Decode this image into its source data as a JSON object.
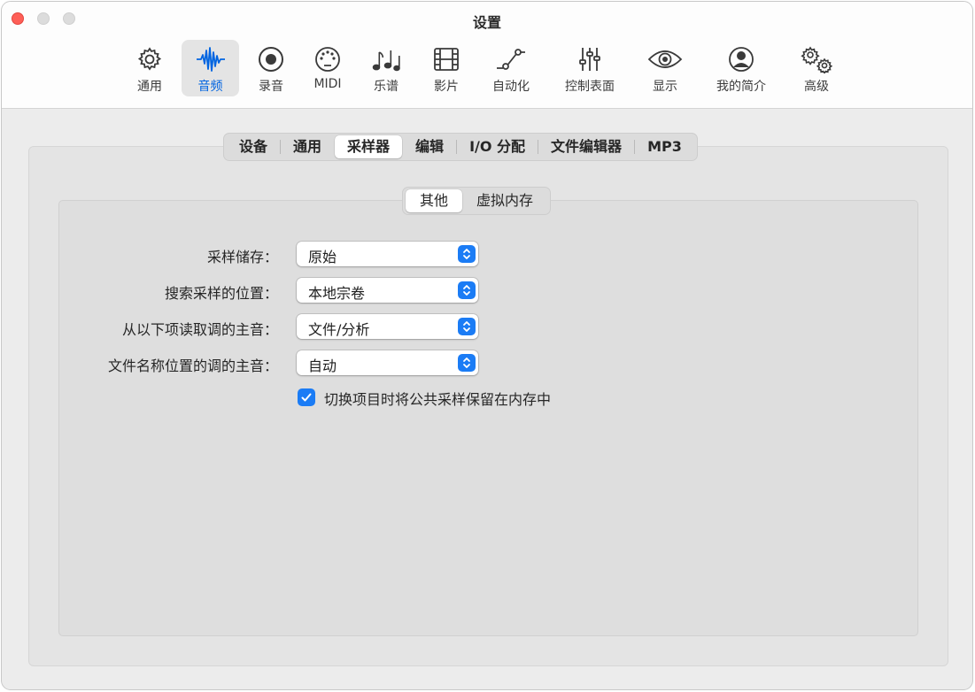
{
  "window": {
    "title": "设置"
  },
  "toolbar": {
    "items": [
      {
        "label": "通用",
        "icon": "gear-icon"
      },
      {
        "label": "音频",
        "icon": "waveform-icon",
        "active": true
      },
      {
        "label": "录音",
        "icon": "record-icon"
      },
      {
        "label": "MIDI",
        "icon": "midi-connector-icon"
      },
      {
        "label": "乐谱",
        "icon": "music-notes-icon"
      },
      {
        "label": "影片",
        "icon": "film-icon"
      },
      {
        "label": "自动化",
        "icon": "automation-curve-icon"
      },
      {
        "label": "控制表面",
        "icon": "sliders-icon"
      },
      {
        "label": "显示",
        "icon": "eye-icon"
      },
      {
        "label": "我的简介",
        "icon": "person-circle-icon"
      },
      {
        "label": "高级",
        "icon": "gears-icon"
      }
    ]
  },
  "tabs": {
    "items": [
      "设备",
      "通用",
      "采样器",
      "编辑",
      "I/O 分配",
      "文件编辑器",
      "MP3"
    ],
    "active": "采样器"
  },
  "subtabs": {
    "items": [
      "其他",
      "虚拟内存"
    ],
    "active": "其他"
  },
  "settings": {
    "rows": [
      {
        "label": "采样储存：",
        "value": "原始"
      },
      {
        "label": "搜索采样的位置：",
        "value": "本地宗卷"
      },
      {
        "label": "从以下项读取调的主音：",
        "value": "文件/分析"
      },
      {
        "label": "文件名称位置的调的主音：",
        "value": "自动"
      }
    ],
    "checkbox": {
      "label": "切换项目时将公共采样保留在内存中",
      "checked": true
    }
  },
  "colors": {
    "accent": "#1b7cf5",
    "active_label": "#0064e1",
    "close_button": "#fe5f57"
  }
}
